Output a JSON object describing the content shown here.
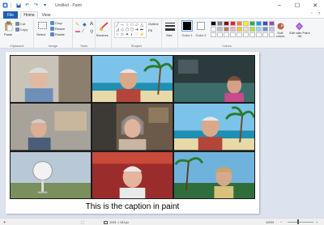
{
  "window": {
    "title": "Untitled - Paint",
    "minimize_label": "–",
    "maximize_label": "☐",
    "close_label": "✕"
  },
  "quick_access": [
    "save-icon",
    "undo-icon",
    "redo-icon",
    "customize-icon"
  ],
  "tabs": {
    "file": "File",
    "home": "Home",
    "view": "View"
  },
  "ribbon": {
    "clipboard": {
      "label": "Clipboard",
      "paste": "Paste",
      "cut": "Cut",
      "copy": "Copy"
    },
    "image": {
      "label": "Image",
      "select": "Select",
      "crop": "Crop",
      "resize": "Resize",
      "rotate": "Rotate"
    },
    "tools": {
      "label": "Tools"
    },
    "brushes": {
      "label": "Brushes"
    },
    "shapes": {
      "label": "Shapes",
      "outline": "Outline",
      "fill": "Fill"
    },
    "size": {
      "label": "Size"
    },
    "colors": {
      "label": "Colors",
      "color1": "Color 1",
      "color2": "Color 2",
      "edit_colors": "Edit colors",
      "edit_with_paint3d": "Edit with Paint 3D"
    }
  },
  "palette": [
    "#000000",
    "#7f7f7f",
    "#880015",
    "#ed1c24",
    "#ff7f27",
    "#fff200",
    "#22b14c",
    "#00a2e8",
    "#3f48cc",
    "#a349a4",
    "#ffffff",
    "#c3c3c3",
    "#b97a57",
    "#ffaec9",
    "#ffc90e",
    "#efe4b0",
    "#b5e61d",
    "#99d9ea",
    "#7092be",
    "#c8bfe7",
    "#ffffff",
    "#ffffff",
    "#ffffff",
    "#ffffff",
    "#ffffff",
    "#ffffff",
    "#ffffff",
    "#ffffff",
    "#ffffff",
    "#ffffff"
  ],
  "color1": "#000000",
  "color2": "#ffffff",
  "participants": [
    {
      "name": "",
      "background": "office"
    },
    {
      "name": "",
      "background": "beach"
    },
    {
      "name": "",
      "background": "room"
    },
    {
      "name": "",
      "background": "kitchen"
    },
    {
      "name": "",
      "background": "home"
    },
    {
      "name": "",
      "background": "beach"
    },
    {
      "name": "",
      "background": "observatory"
    },
    {
      "name": "",
      "background": "red"
    },
    {
      "name": "",
      "background": "palms"
    }
  ],
  "caption": "This is the caption in paint",
  "status": {
    "size": "1001 × 611px",
    "zoom": "100%"
  }
}
